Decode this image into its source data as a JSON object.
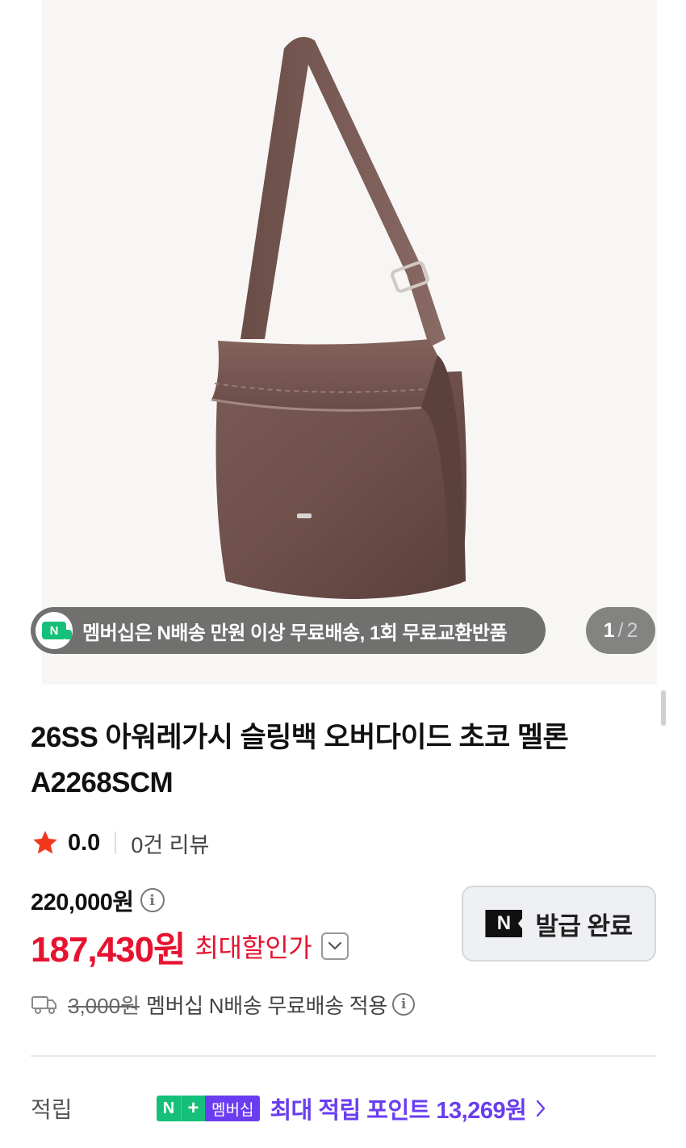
{
  "gallery": {
    "promo_text": "멤버십은 N배송 만원 이상 무료배송, 1회 무료교환반품",
    "promo_icon_letter": "N",
    "page_current": "1",
    "page_separator": "/",
    "page_total": "2"
  },
  "product": {
    "title": "26SS 아워레가시 슬링백 오버다이드 초코 멜론 A2268SCM",
    "rating": "0.0",
    "review_count": "0건 리뷰",
    "original_price": "220,000원",
    "sale_price": "187,430원",
    "sale_label": "최대할인가"
  },
  "coupon": {
    "badge": "N",
    "label": "발급 완료"
  },
  "shipping": {
    "fee": "3,000원",
    "note": "멤버십 N배송 무료배송 적용"
  },
  "points": {
    "label": "적립",
    "badge_n": "N",
    "badge_plus": "+",
    "badge_membership": "멤버십",
    "text": "최대 적립 포인트 13,269원"
  },
  "colors": {
    "sale_red": "#e5132f",
    "membership_purple": "#6a3df0",
    "naver_green": "#16c07a"
  }
}
